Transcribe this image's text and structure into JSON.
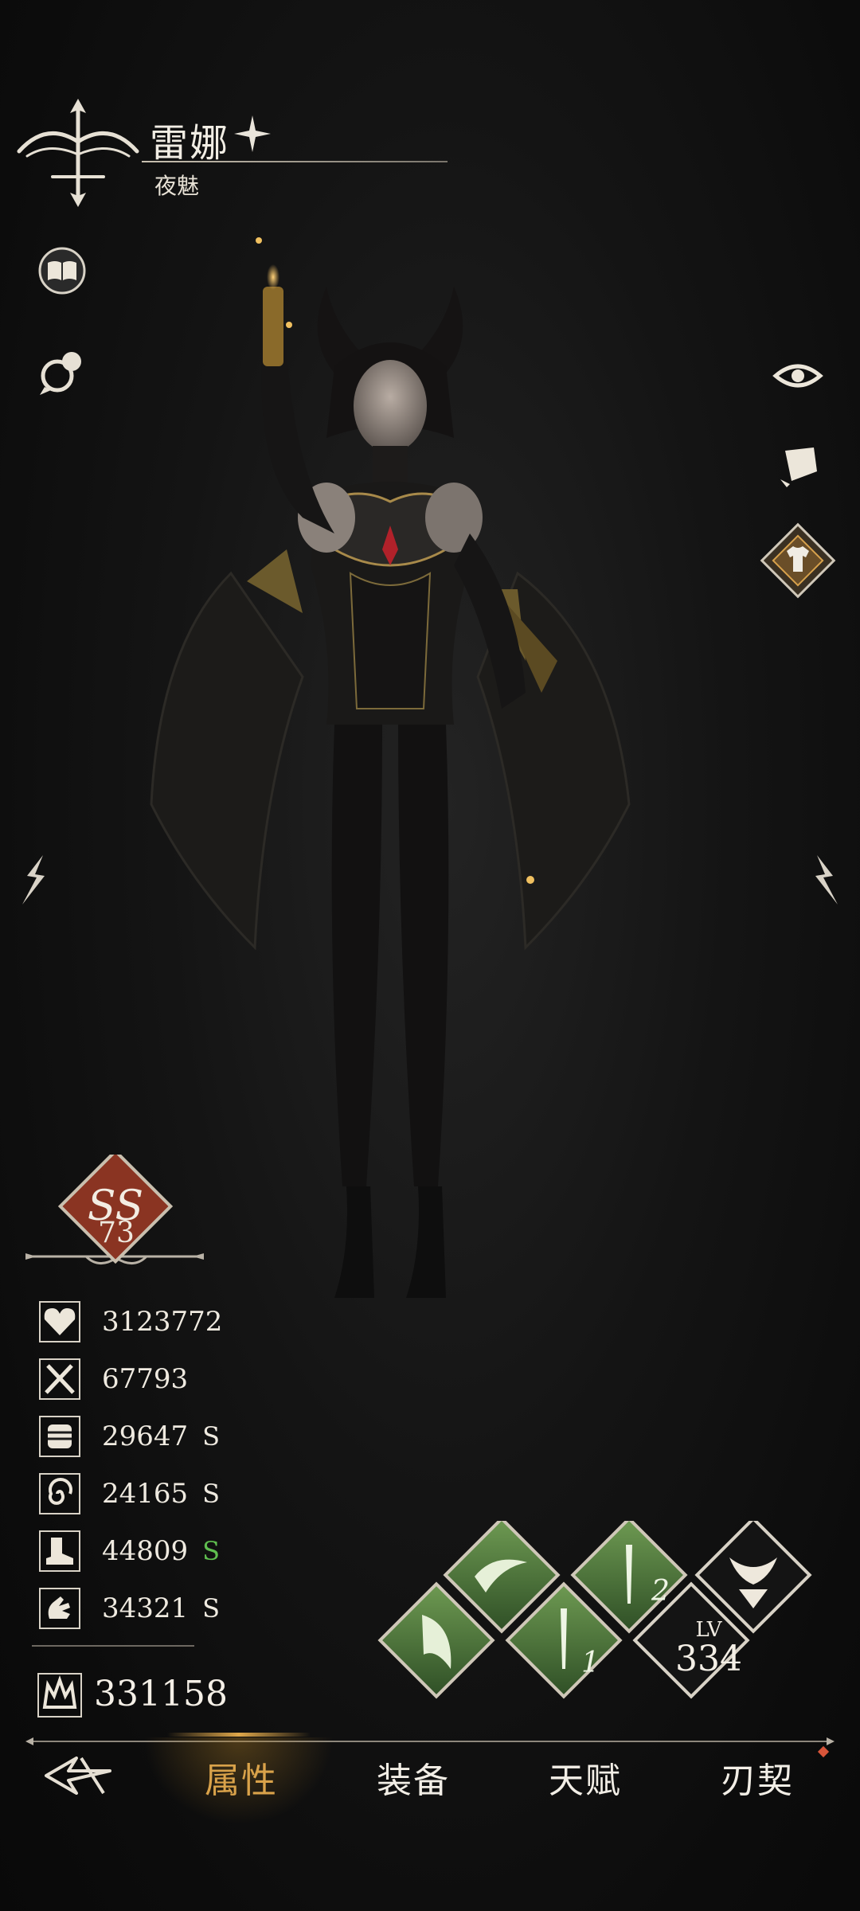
{
  "hero": {
    "name": "雷娜",
    "subtitle": "夜魅",
    "class_icon": "bow-class-icon"
  },
  "side_buttons": {
    "left": [
      "book-icon",
      "chat-icon"
    ],
    "right": [
      "eye-icon",
      "card-icon",
      "costume-icon"
    ]
  },
  "rank": {
    "grade": "SS",
    "level": "73"
  },
  "stats": [
    {
      "icon": "health-heart-icon",
      "value": "3123772",
      "grade": ""
    },
    {
      "icon": "attack-swords-icon",
      "value": "67793",
      "grade": ""
    },
    {
      "icon": "fist-icon",
      "value": "29647",
      "grade": "S"
    },
    {
      "icon": "spiral-icon",
      "value": "24165",
      "grade": "S"
    },
    {
      "icon": "boot-icon",
      "value": "44809",
      "grade": "S"
    },
    {
      "icon": "hand-icon",
      "value": "34321",
      "grade": "S"
    }
  ],
  "power": {
    "icon": "crown-power-icon",
    "value": "331158"
  },
  "skills": {
    "lv_label": "LV",
    "lv_value": "334",
    "skill1_num": "1",
    "skill2_num": "2"
  },
  "tabs": [
    {
      "label": "属性",
      "active": true
    },
    {
      "label": "装备",
      "active": false
    },
    {
      "label": "天赋",
      "active": false
    },
    {
      "label": "刃契",
      "active": false
    }
  ],
  "colors": {
    "accent_gold": "#d9a24a",
    "grade_green": "#5fbe4f",
    "skill_green": "#4c7a38",
    "rank_red": "#8a3422"
  }
}
